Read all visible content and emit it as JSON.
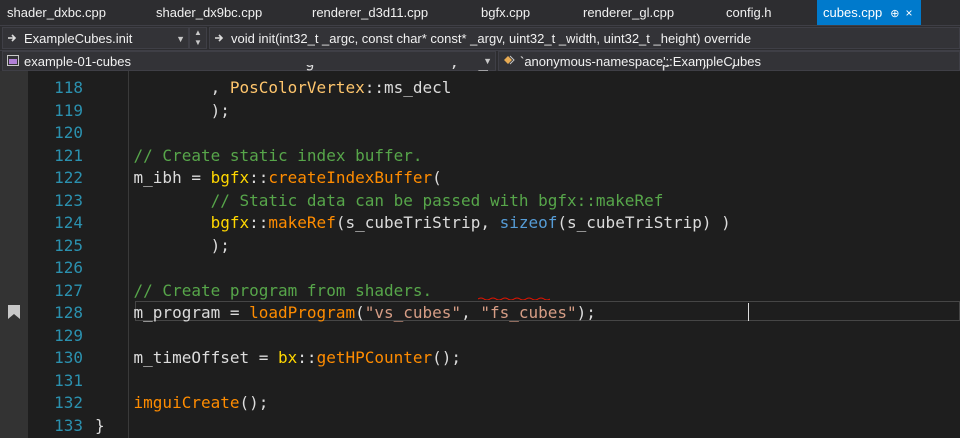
{
  "tabs": [
    {
      "label": "shader_dxbc.cpp",
      "active": false
    },
    {
      "label": "shader_dx9bc.cpp",
      "active": false
    },
    {
      "label": "renderer_d3d11.cpp",
      "active": false
    },
    {
      "label": "bgfx.cpp",
      "active": false
    },
    {
      "label": "renderer_gl.cpp",
      "active": false
    },
    {
      "label": "config.h",
      "active": false
    },
    {
      "label": "cubes.cpp",
      "active": true,
      "pin_glyph": "⊕",
      "close_glyph": "×"
    }
  ],
  "nav": {
    "scope": "ExampleCubes.init",
    "member": "void init(int32_t _argc, const char* const* _argv, uint32_t _width, uint32_t _height) override",
    "project": "example-01-cubes",
    "namespace": "`anonymous-namespace'::ExampleCubes"
  },
  "icons": {
    "scope": "function-icon",
    "member": "method-icon",
    "project": "project-icon",
    "namespace": "class-icon",
    "bookmark": "bookmark-icon"
  },
  "editor": {
    "current_line": "128",
    "lines": [
      {
        "num": "118",
        "tokens": [
          {
            "t": "            , ",
            "c": "pl"
          },
          {
            "t": "PosColorVertex",
            "c": "tp"
          },
          {
            "t": "::",
            "c": "pl"
          },
          {
            "t": "ms_decl",
            "c": "pl"
          }
        ]
      },
      {
        "num": "119",
        "tokens": [
          {
            "t": "            );",
            "c": "pl"
          }
        ]
      },
      {
        "num": "120",
        "tokens": []
      },
      {
        "num": "121",
        "tokens": [
          {
            "t": "    // Create static index buffer.",
            "c": "cm"
          }
        ]
      },
      {
        "num": "122",
        "tokens": [
          {
            "t": "    m_ibh = ",
            "c": "pl"
          },
          {
            "t": "bgfx",
            "c": "ns"
          },
          {
            "t": "::",
            "c": "pl"
          },
          {
            "t": "createIndexBuffer",
            "c": "fn"
          },
          {
            "t": "(",
            "c": "pl"
          }
        ]
      },
      {
        "num": "123",
        "tokens": [
          {
            "t": "            // Static data can be passed with bgfx::makeRef",
            "c": "cm"
          }
        ]
      },
      {
        "num": "124",
        "tokens": [
          {
            "t": "            ",
            "c": "pl"
          },
          {
            "t": "bgfx",
            "c": "ns"
          },
          {
            "t": "::",
            "c": "pl"
          },
          {
            "t": "makeRef",
            "c": "fn"
          },
          {
            "t": "(s_cubeTriStrip, ",
            "c": "pl"
          },
          {
            "t": "sizeof",
            "c": "kw"
          },
          {
            "t": "(s_cubeTriStrip) )",
            "c": "pl"
          }
        ]
      },
      {
        "num": "125",
        "tokens": [
          {
            "t": "            );",
            "c": "pl"
          }
        ]
      },
      {
        "num": "126",
        "tokens": []
      },
      {
        "num": "127",
        "tokens": [
          {
            "t": "    // Create program from shaders.",
            "c": "cm"
          }
        ]
      },
      {
        "num": "128",
        "tokens": [
          {
            "t": "    m_program = ",
            "c": "pl"
          },
          {
            "t": "loadProgram",
            "c": "fn"
          },
          {
            "t": "(",
            "c": "pl"
          },
          {
            "t": "\"vs_cubes\"",
            "c": "st"
          },
          {
            "t": ", ",
            "c": "pl"
          },
          {
            "t": "\"fs_cubes\"",
            "c": "st"
          },
          {
            "t": ");",
            "c": "pl"
          }
        ]
      },
      {
        "num": "129",
        "tokens": []
      },
      {
        "num": "130",
        "tokens": [
          {
            "t": "    m_timeOffset = ",
            "c": "pl"
          },
          {
            "t": "bx",
            "c": "ns"
          },
          {
            "t": "::",
            "c": "pl"
          },
          {
            "t": "getHPCounter",
            "c": "fn"
          },
          {
            "t": "();",
            "c": "pl"
          }
        ]
      },
      {
        "num": "131",
        "tokens": []
      },
      {
        "num": "132",
        "tokens": [
          {
            "t": "    ",
            "c": "pl"
          },
          {
            "t": "imguiCreate",
            "c": "fn"
          },
          {
            "t": "();",
            "c": "pl"
          }
        ]
      },
      {
        "num": "133",
        "tokens": [
          {
            "t": "}",
            "c": "pl"
          }
        ]
      }
    ]
  }
}
